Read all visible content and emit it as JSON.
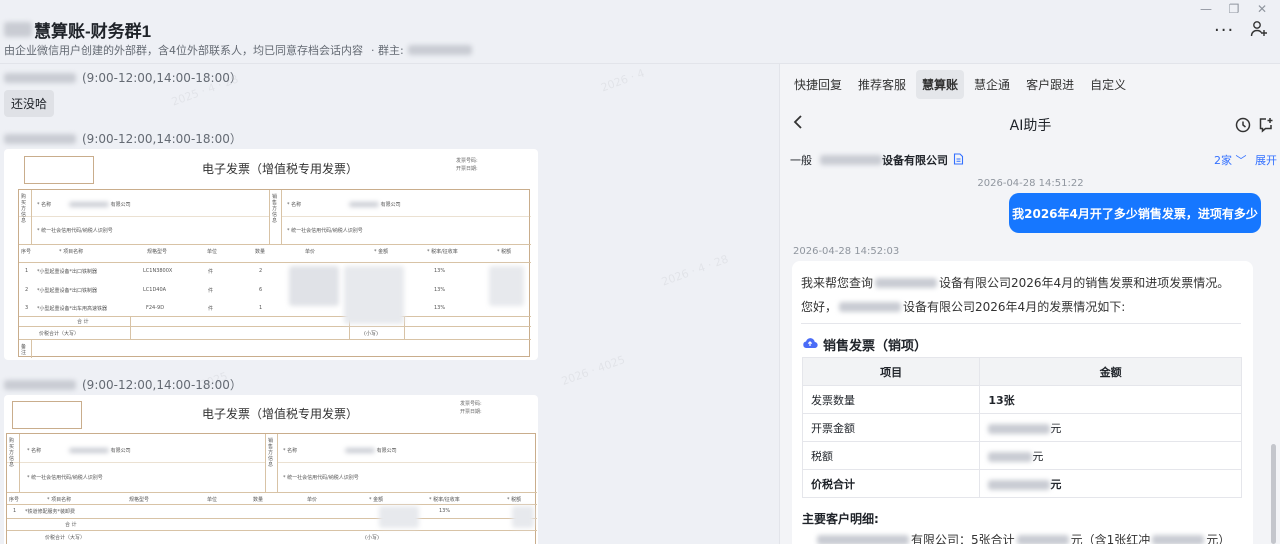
{
  "window": {
    "title": "慧算账-财务群1",
    "subtitle": "由企业微信用户创建的外部群，含4位外部联系人，均已同意存档会话内容",
    "owner_label": "· 群主:",
    "controls": {
      "minimize": "—",
      "restore": "❐",
      "close": "✕"
    }
  },
  "chat": {
    "messages": [
      {
        "hours": "(9:00-12:00,14:00-18:00）",
        "text": "还没哈"
      },
      {
        "hours": "(9:00-12:00,14:00-18:00）"
      },
      {
        "hours": "(9:00-12:00,14:00-18:00）"
      }
    ],
    "invoice": {
      "title": "电子发票（增值税专用发票）",
      "meta": [
        "发票号码:",
        "开票日期:"
      ],
      "buyer_label": "购买方信息",
      "seller_label": "销售方信息",
      "name_label": "* 名称",
      "name_value": "有限公司",
      "tax_label": "* 统一社会信用代码/纳税人识别号",
      "headers": [
        "序号",
        "* 项目名称",
        "规格型号",
        "单位",
        "数量",
        "单价",
        "* 金额",
        "* 税率/征收率",
        "* 税额"
      ],
      "rows1": [
        [
          "1",
          "*小型起重设备*出口铁制器",
          "LC1N3800X",
          "件",
          "2",
          "13%"
        ],
        [
          "2",
          "*小型起重设备*出口铁制器",
          "LC1D40A",
          "件",
          "6",
          "13%"
        ],
        [
          "3",
          "*小型起重设备*出车用高速铁器",
          "F24-9D",
          "件",
          "1",
          "13%"
        ]
      ],
      "rows2": [
        [
          "1",
          "*铁道修配服务*装卸费",
          "13%"
        ]
      ],
      "total_label": "合 计",
      "grand_label": "价税合计（大写）",
      "small_label": "(小写)",
      "remark_label": "备注"
    }
  },
  "panel": {
    "tabs": [
      "快捷回复",
      "推荐客服",
      "慧算账",
      "慧企通",
      "客户跟进",
      "自定义"
    ],
    "active_tab": 2,
    "ai_title": "AI助手",
    "company_prefix": "一般",
    "company_name": "设备有限公司",
    "home_count": "2家",
    "expand": "展开",
    "user_time": "2026-04-28 14:51:22",
    "user_message": "我2026年4月开了多少销售发票，进项有多少",
    "ai_time": "2026-04-28 14:52:03",
    "ai_line1_prefix": "我来帮您查询",
    "ai_line1_suffix": "设备有限公司2026年4月的销售发票和进项发票情况。",
    "ai_line2_prefix": "您好，",
    "ai_line2_suffix": "设备有限公司2026年4月的发票情况如下:",
    "section_title": "销售发票（销项）",
    "table_headers": [
      "项目",
      "金额"
    ],
    "table_rows": [
      {
        "item": "发票数量",
        "value": "13张"
      },
      {
        "item": "开票金额",
        "value": "元"
      },
      {
        "item": "税额",
        "value": "元"
      },
      {
        "item": "价税合计",
        "value": "元"
      }
    ],
    "detail_title": "主要客户明细:",
    "detail_a": "有限公司：5张合计",
    "detail_b": "元（含1张红冲",
    "detail_c": "元）"
  },
  "colors": {
    "accent": "#1677ff",
    "link": "#3370ff",
    "invoice_line": "#c9ad8c"
  }
}
